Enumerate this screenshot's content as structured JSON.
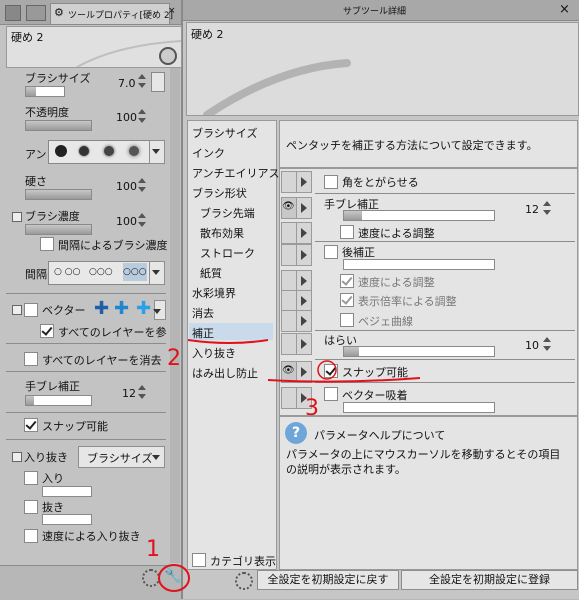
{
  "left": {
    "tab_label": "ツールプロパティ[硬め 2]",
    "preview_name": "硬め 2",
    "brush_size_label": "ブラシサイズ",
    "brush_size_value": "7.0",
    "opacity_label": "不透明度",
    "opacity_value": "100",
    "anti_alias_label": "アン",
    "hardness_label": "硬さ",
    "hardness_value": "100",
    "brush_density_label": "ブラシ濃度",
    "brush_density_value": "100",
    "interval_density_label": "間隔によるブラシ濃度",
    "interval_label": "間隔",
    "vector_label": "ベクター",
    "all_layers_ref_label": "すべてのレイヤーを参",
    "all_layers_erase_label": "すべてのレイヤーを消去",
    "stabilization_label": "手ブレ補正",
    "stabilization_value": "12",
    "snap_label": "スナップ可能",
    "in_out_label": "入り抜き",
    "in_out_select": "ブラシサイズ",
    "in_label": "入り",
    "out_label": "抜き",
    "speed_in_out_label": "速度による入り抜き"
  },
  "dialog": {
    "title": "サブツール詳細",
    "preview_name": "硬め 2",
    "categories": [
      "ブラシサイズ",
      "インク",
      "アンチエイリアス",
      "ブラシ形状",
      "ブラシ先端",
      "散布効果",
      "ストローク",
      "紙質",
      "水彩境界",
      "消去",
      "補正",
      "入り抜き",
      "はみ出し防止"
    ],
    "category_display_label": "カテゴリ表示",
    "description": "ペンタッチを補正する方法について設定できます。",
    "settings": {
      "sharpen_corners": "角をとがらせる",
      "stabilization": "手ブレ補正",
      "stabilization_value": "12",
      "speed_adjust": "速度による調整",
      "post_correction": "後補正",
      "speed_adjust2": "速度による調整",
      "display_ratio_adjust": "表示倍率による調整",
      "bezier": "ベジェ曲線",
      "harai": "はらい",
      "harai_value": "10",
      "snap": "スナップ可能",
      "vector_magnet": "ベクター吸着"
    },
    "help_title": "パラメータヘルプについて",
    "help_text": "パラメータの上にマウスカーソルを移動するとその項目の説明が表示されます。",
    "reset_all_button": "全設定を初期設定に戻す",
    "register_all_button": "全設定を初期設定に登録"
  },
  "annotations": {
    "n1": "1",
    "n2": "2",
    "n3": "3"
  },
  "colors": {
    "annotation_red": "#e0121b",
    "selected_category": "#c9dbea"
  }
}
